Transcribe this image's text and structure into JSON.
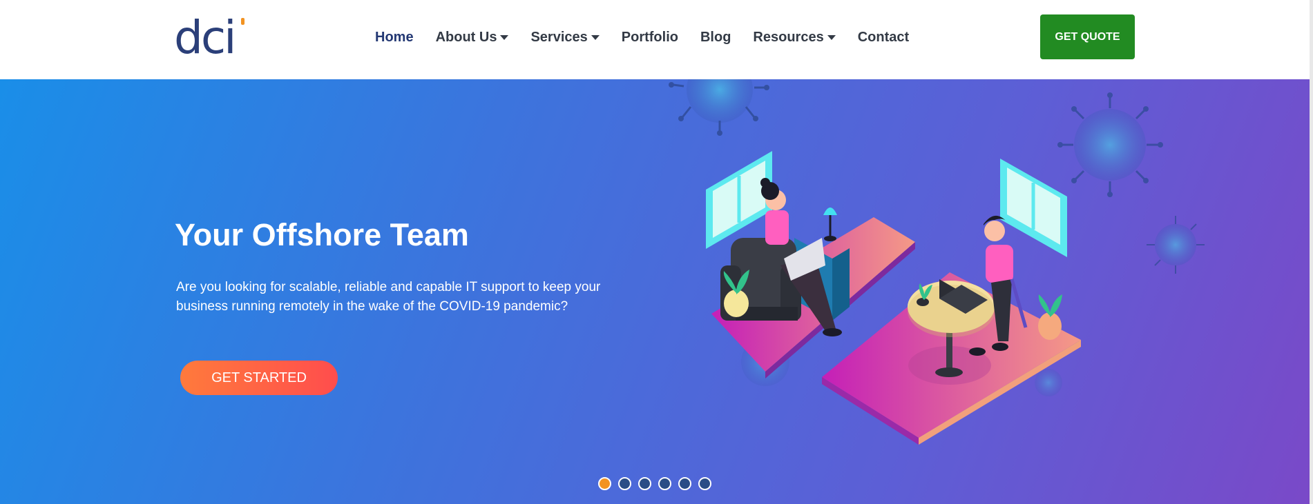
{
  "brand": {
    "logo_text": "dci"
  },
  "nav": {
    "items": [
      {
        "label": "Home",
        "dropdown": false,
        "active": true
      },
      {
        "label": "About Us",
        "dropdown": true,
        "active": false
      },
      {
        "label": "Services",
        "dropdown": true,
        "active": false
      },
      {
        "label": "Portfolio",
        "dropdown": false,
        "active": false
      },
      {
        "label": "Blog",
        "dropdown": false,
        "active": false
      },
      {
        "label": "Resources",
        "dropdown": true,
        "active": false
      },
      {
        "label": "Contact",
        "dropdown": false,
        "active": false
      }
    ],
    "quote_label": "GET QUOTE"
  },
  "hero": {
    "title": "Your Offshore Team",
    "text": "Are you looking for scalable, reliable and capable IT support to keep your business running remotely in the wake of the COVID-19 pandemic?",
    "cta_label": "GET STARTED",
    "slide_count": 6,
    "active_slide": 1
  },
  "colors": {
    "brand": "#2b3f79",
    "accent": "#f29322",
    "quote_button": "#228b22",
    "hero_gradient_start": "#1a8ee8",
    "hero_gradient_end": "#7a49c8",
    "cta_gradient_start": "#ff7a3c",
    "cta_gradient_end": "#ff4d4d"
  }
}
